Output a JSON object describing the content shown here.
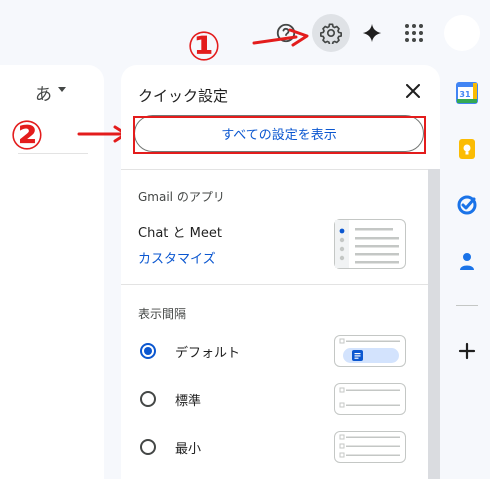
{
  "annotations": {
    "step1": "①",
    "step2": "②"
  },
  "header": {
    "help_icon": "help-icon",
    "settings_icon": "gear-icon",
    "gemini_icon": "sparkle-icon",
    "apps_icon": "apps-grid-icon",
    "avatar": "avatar"
  },
  "left_panel": {
    "input_tool_label": "あ"
  },
  "quick_settings": {
    "title": "クイック設定",
    "show_all_label": "すべての設定を表示",
    "apps_section_title": "Gmail のアプリ",
    "chat_meet_label": "Chat と Meet",
    "customize_label": "カスタマイズ",
    "density_section_title": "表示間隔",
    "density_options": [
      {
        "label": "デフォルト",
        "selected": true
      },
      {
        "label": "標準",
        "selected": false
      },
      {
        "label": "最小",
        "selected": false
      }
    ]
  },
  "side_rail": {
    "calendar_day": "31",
    "icons": [
      "calendar-icon",
      "keep-icon",
      "tasks-icon",
      "contacts-icon",
      "add-icon"
    ]
  },
  "colors": {
    "annotation": "#e31c1c",
    "accent": "#0b57d0",
    "background": "#f6f8fc"
  }
}
